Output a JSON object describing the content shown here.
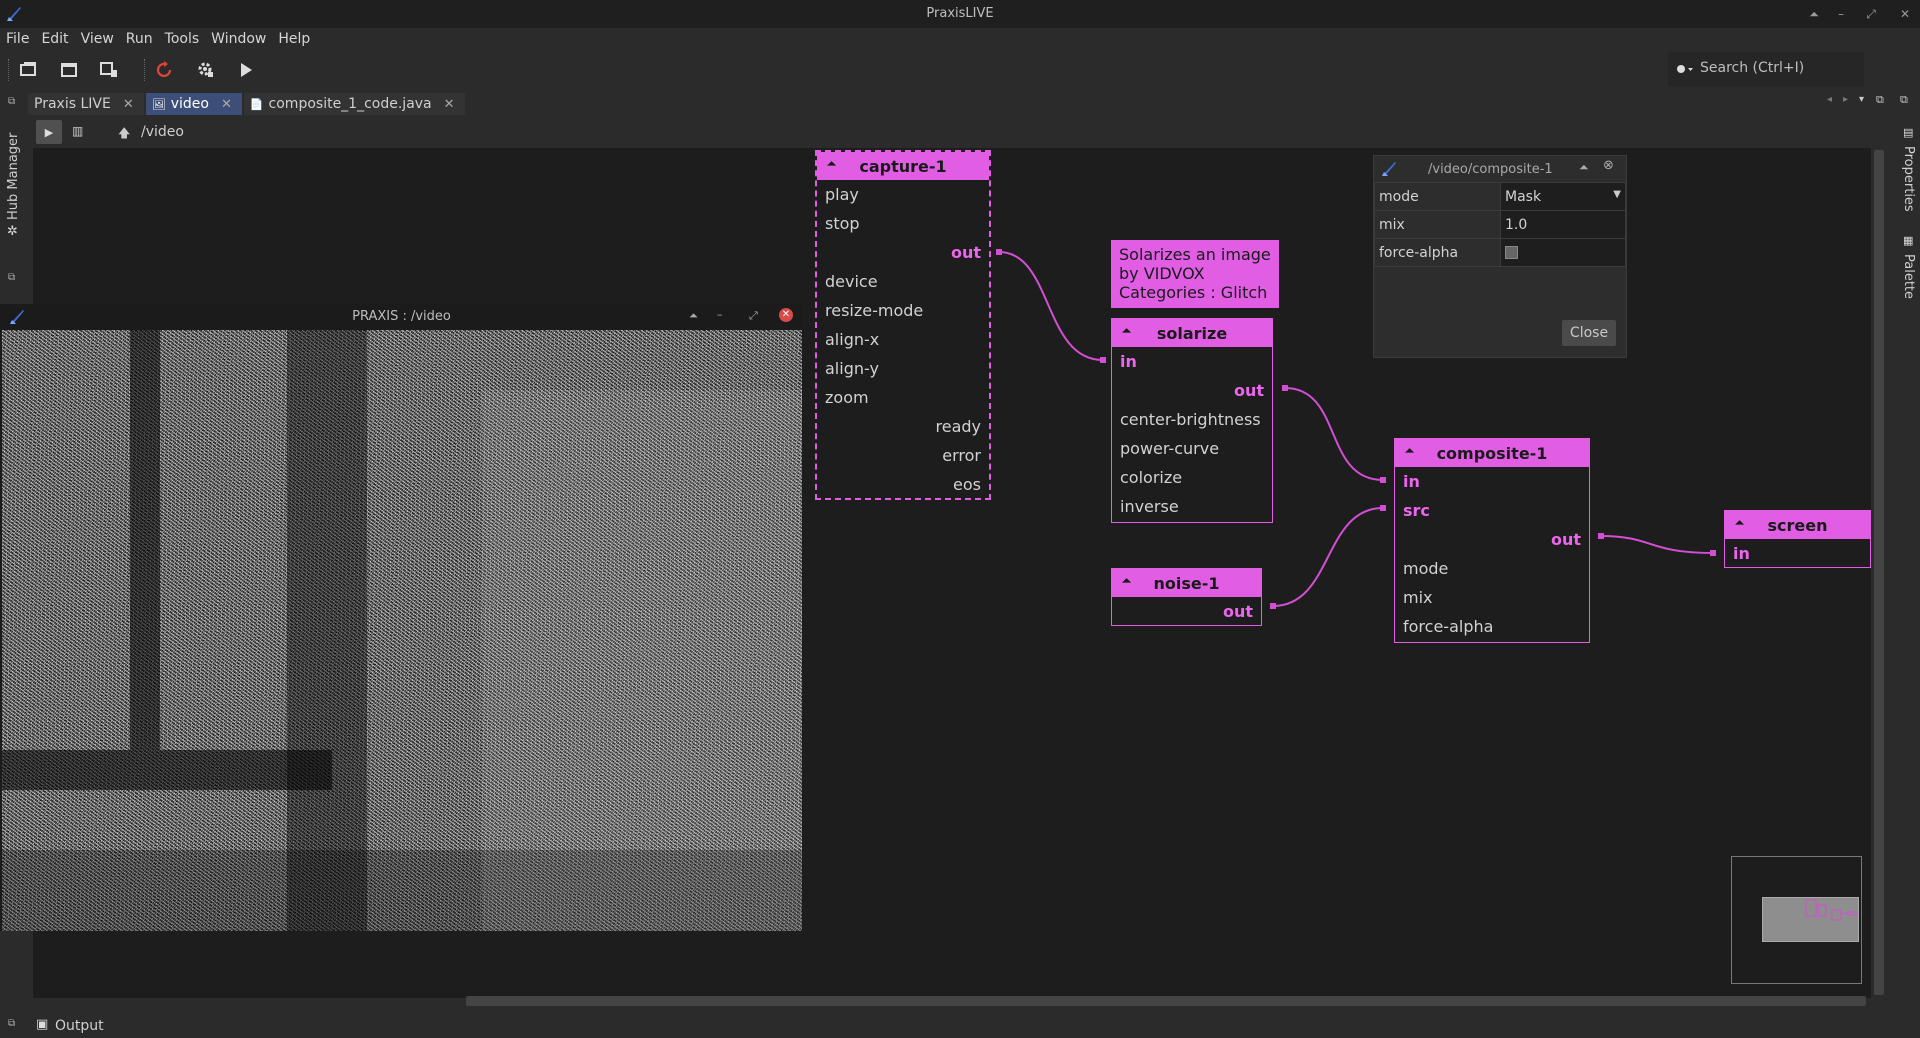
{
  "window": {
    "title": "PraxisLIVE"
  },
  "menu": [
    "File",
    "Edit",
    "View",
    "Run",
    "Tools",
    "Window",
    "Help"
  ],
  "search": {
    "placeholder": "Search (Ctrl+I)"
  },
  "left_rail": {
    "hub_manager": "Hub Manager"
  },
  "right_rail": {
    "properties": "Properties",
    "palette": "Palette"
  },
  "tabs": [
    {
      "label": "Praxis LIVE",
      "active": false
    },
    {
      "label": "video",
      "active": true
    },
    {
      "label": "composite_1_code.java",
      "active": false
    }
  ],
  "editor": {
    "path": "/video"
  },
  "nodes": {
    "capture": {
      "title": "capture-1",
      "ports": [
        "play",
        "stop",
        "out",
        "device",
        "resize-mode",
        "align-x",
        "align-y",
        "zoom",
        "ready",
        "error",
        "eos"
      ]
    },
    "solarize": {
      "title": "solarize",
      "ports": [
        "in",
        "out",
        "center-brightness",
        "power-curve",
        "colorize",
        "inverse"
      ]
    },
    "noise": {
      "title": "noise-1",
      "ports": [
        "out"
      ]
    },
    "composite": {
      "title": "composite-1",
      "ports": [
        "in",
        "src",
        "out",
        "mode",
        "mix",
        "force-alpha"
      ]
    },
    "screen": {
      "title": "screen",
      "ports": [
        "in"
      ]
    }
  },
  "tooltip": {
    "line1": "Solarizes an image",
    "line2": "by VIDVOX",
    "line3": "Categories : Glitch"
  },
  "properties_panel": {
    "title": "/video/composite-1",
    "rows": [
      {
        "name": "mode",
        "value": "Mask"
      },
      {
        "name": "mix",
        "value": "1.0"
      },
      {
        "name": "force-alpha",
        "value": ""
      }
    ],
    "close_label": "Close"
  },
  "video_window": {
    "title": "PRAXIS : /video"
  },
  "output": {
    "label": "Output"
  },
  "colors": {
    "accent": "#e15ee4",
    "canvas": "#1d1d1d",
    "chrome": "#2b2b2b"
  }
}
